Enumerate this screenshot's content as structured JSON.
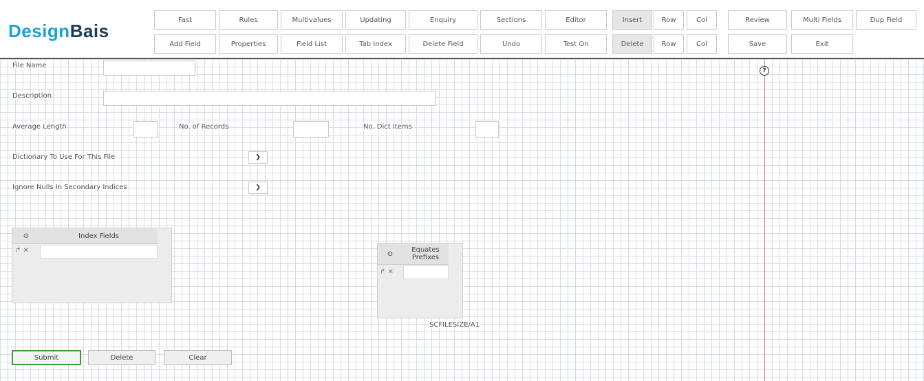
{
  "app": {
    "logo_part1": "Design",
    "logo_part2": "Bais"
  },
  "toolbar": {
    "row1": {
      "fast": "Fast",
      "rules": "Rules",
      "multivalues": "Multivalues",
      "updating": "Updating",
      "enquiry": "Enquiry",
      "sections": "Sections",
      "editor": "Editor",
      "insert": "Insert",
      "insert_row": "Row",
      "insert_col": "Col",
      "review": "Review",
      "multi_fields": "Multi Fields",
      "dup_field": "Dup Field"
    },
    "row2": {
      "add_field": "Add Field",
      "properties": "Properties",
      "field_list": "Field List",
      "tab_index": "Tab Index",
      "delete_field": "Delete Field",
      "undo": "Undo",
      "test_on": "Test On",
      "delete": "Delete",
      "delete_row": "Row",
      "delete_col": "Col",
      "save": "Save",
      "exit": "Exit"
    }
  },
  "form": {
    "file_name_label": "File Name",
    "description_label": "Description",
    "average_length_label": "Average Length",
    "no_records_label": "No. of Records",
    "no_dict_items_label": "No. Dict Items",
    "dictionary_label": "Dictionary To Use For This File",
    "ignore_nulls_label": "Ignore Nulls In Secondary Indices",
    "file_name_value": "",
    "description_value": "",
    "average_length_value": "",
    "no_records_value": "",
    "no_dict_items_value": ""
  },
  "index_grid": {
    "header": "Index Fields",
    "add_icon": "⊙",
    "row_icons": "↱ ✕"
  },
  "equates_grid": {
    "header_line1": "Equates",
    "header_line2": "Prefixes",
    "add_icon": "⊙",
    "row_icons": "↱ ✕"
  },
  "filesize_label": "SCFILESIZE/A1",
  "buttons": {
    "submit": "Submit",
    "delete": "Delete",
    "clear": "Clear"
  },
  "help_icon": "?",
  "colors": {
    "accent": "#1ba3d8",
    "brand_dark": "#1f3d5c",
    "guide_line": "#e57373",
    "submit_border": "#3c9a3c"
  }
}
